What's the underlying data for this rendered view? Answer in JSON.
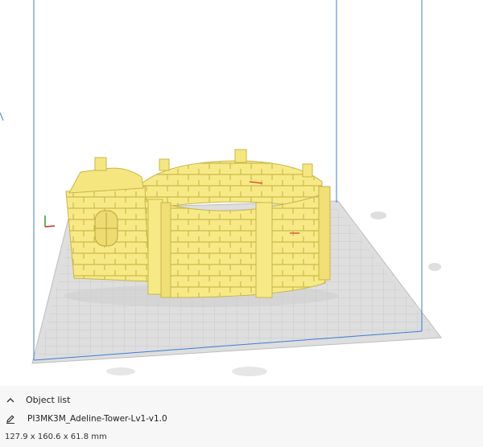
{
  "object_list": {
    "header_label": "Object list",
    "chevron_icon": "chevron-up-icon",
    "edit_icon": "pencil-icon",
    "object_name": "PI3MK3M_Adeline-Tower-Lv1-v1.0",
    "dimensions": "127.9 x 160.6 x 61.8 mm"
  },
  "colors": {
    "model": "#f8ec8a",
    "model_shadow": "#d9c95a",
    "plate": "#dcdcdc",
    "grid": "#c6c6c6",
    "volume_edge": "#3d7bd6",
    "panel_bg": "#f7f7f7"
  }
}
